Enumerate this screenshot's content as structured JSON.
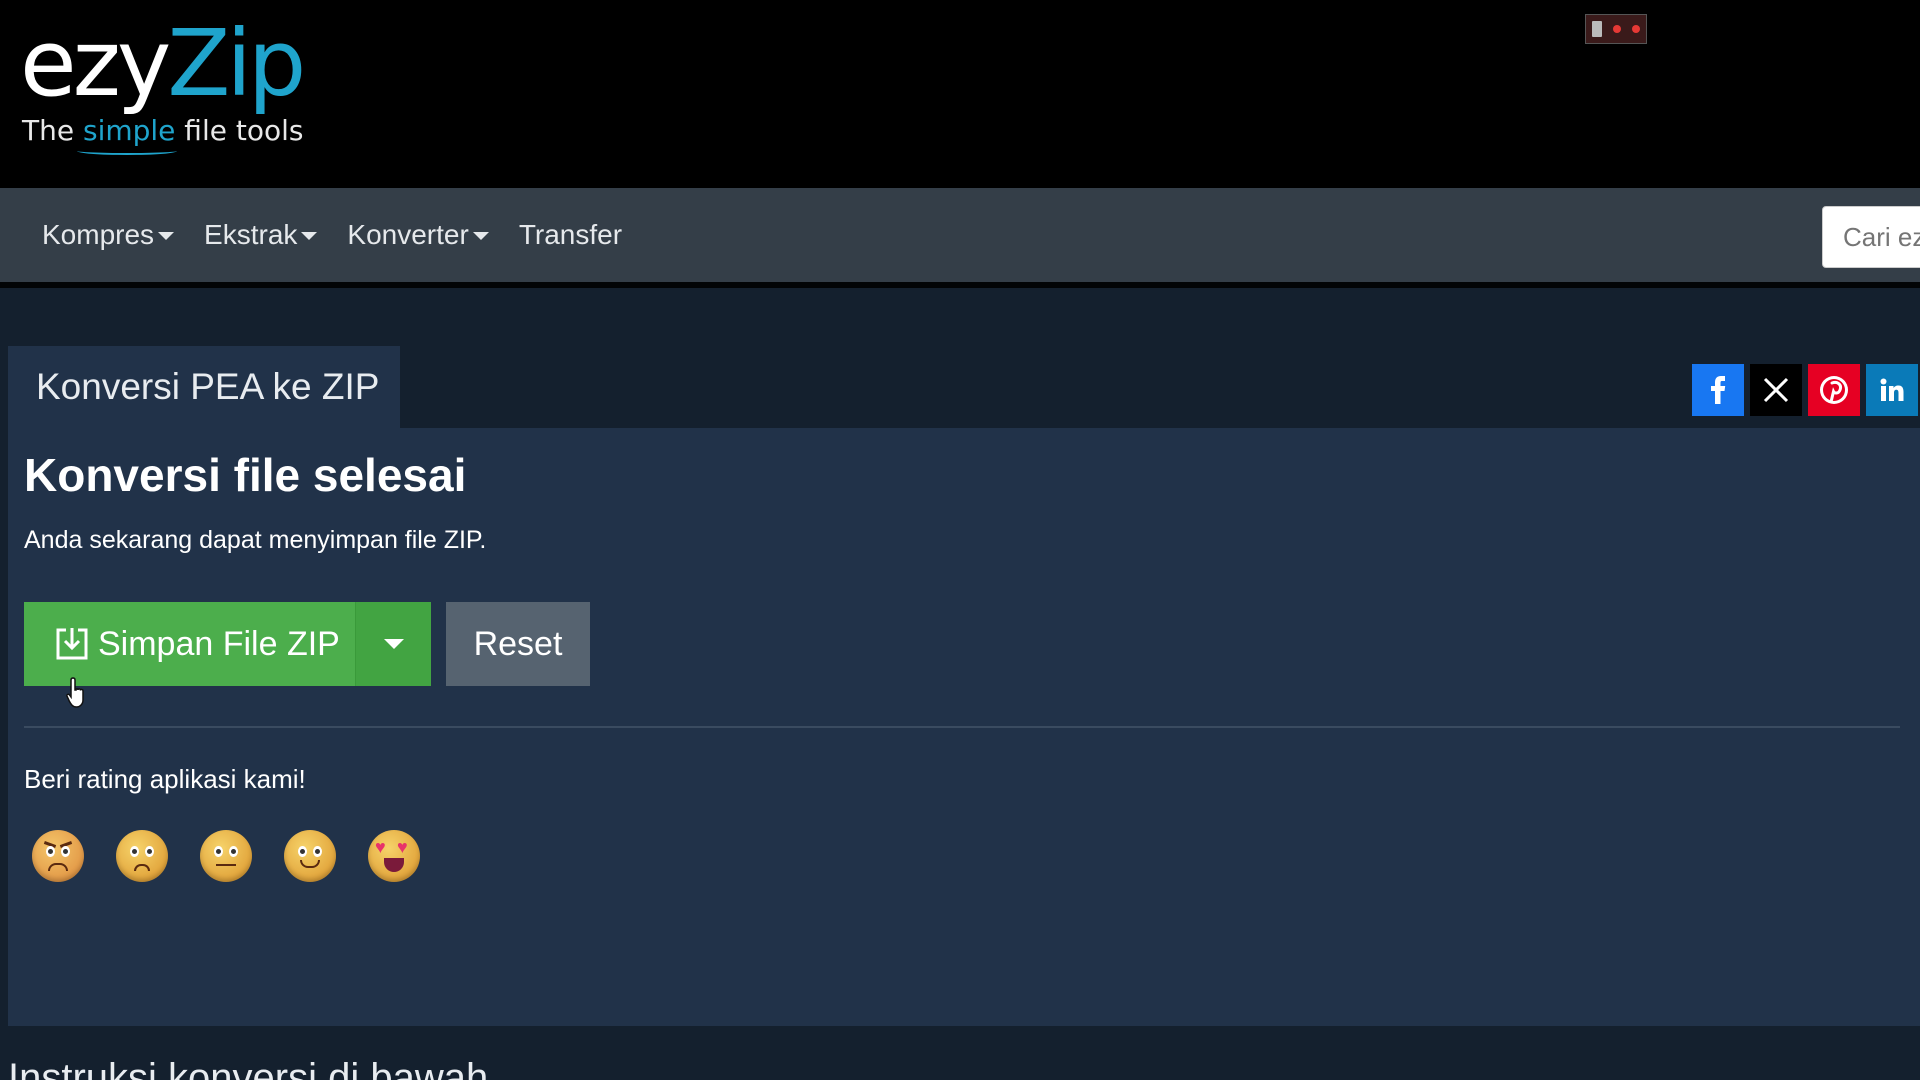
{
  "brand": {
    "logo_part1": "ezy",
    "logo_part2": "Zip",
    "tagline_before": "The ",
    "tagline_highlight": "simple",
    "tagline_after": " file tools",
    "accent_color": "#1fa4cc"
  },
  "nav": {
    "items": [
      {
        "label": "Kompres",
        "dropdown": true
      },
      {
        "label": "Ekstrak",
        "dropdown": true
      },
      {
        "label": "Konverter",
        "dropdown": true
      },
      {
        "label": "Transfer",
        "dropdown": false
      }
    ],
    "search_placeholder": "Cari ezyZip"
  },
  "tab": {
    "title": "Konversi PEA ke ZIP"
  },
  "share": {
    "buttons": [
      "facebook-icon",
      "x-icon",
      "pinterest-icon",
      "linkedin-icon"
    ]
  },
  "result": {
    "heading": "Konversi file selesai",
    "message": "Anda sekarang dapat menyimpan file ZIP.",
    "save_label": "Simpan File ZIP",
    "reset_label": "Reset",
    "save_color": "#4cae4c"
  },
  "rating": {
    "label": "Beri rating aplikasi kami!",
    "faces": [
      "angry-face-icon",
      "sad-face-icon",
      "neutral-face-icon",
      "smile-face-icon",
      "heart-eyes-face-icon"
    ]
  },
  "footer": {
    "instructions": "Instruksi konversi di bawah"
  }
}
